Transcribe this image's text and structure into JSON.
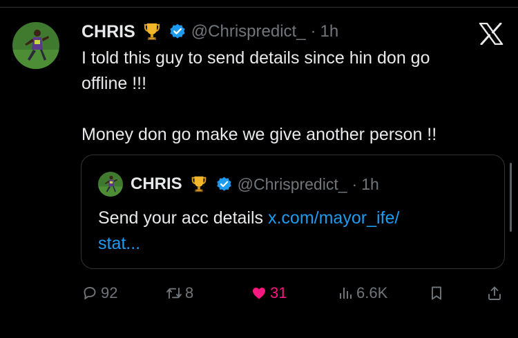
{
  "tweet": {
    "author": {
      "name": "CHRIS",
      "handle": "@Chrispredict_",
      "time": "1h",
      "separator": "·",
      "badges": [
        "trophy-emoji",
        "verified-badge"
      ]
    },
    "text_line1": "I told this guy to send details since hin don go",
    "text_line2": "offline !!!",
    "text_line3": "Money don go make we give another person !!",
    "quoted": {
      "author": {
        "name": "CHRIS",
        "handle": "@Chrispredict_",
        "time": "1h",
        "separator": "·"
      },
      "text": "Send your acc details ",
      "link_line1": "x.com/mayor_ife/",
      "link_line2": "stat..."
    },
    "stats": {
      "replies": "92",
      "reposts": "8",
      "likes": "31",
      "views": "6.6K"
    }
  },
  "platform_logo": "x-logo",
  "colors": {
    "background": "#000000",
    "text": "#e7e9ea",
    "muted": "#71767b",
    "link": "#1d9bf0",
    "like": "#f91880",
    "verified": "#1d9bf0",
    "border": "#2f3336"
  }
}
